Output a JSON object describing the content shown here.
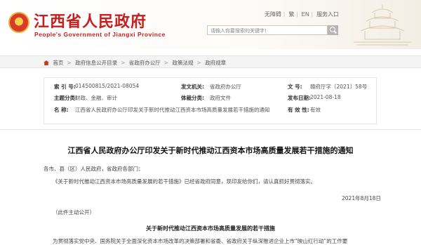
{
  "header": {
    "title": "江西省人民政府",
    "subtitle": "People's Government of Jiangxi Province",
    "links": [
      "无障碍",
      "繁",
      "EN",
      "服务入口"
    ],
    "search_placeholder": "请输入你要搜索的关键字!"
  },
  "breadcrumb": [
    "首页",
    "政府信息公开目录",
    "省政府办公厅",
    "政策法规",
    "政府规章"
  ],
  "meta": {
    "index_label": "索 引 号:",
    "index_value": "014500815/2021-08054",
    "org_label": "发文机关:",
    "org_value": "省政府办公厅",
    "docno_label": "文 号:",
    "docno_value": "赣府厅字〔2021〕58号",
    "category_label": "主题分类:",
    "category_value": "财政、金融、审计",
    "type_label": "体裁分类:",
    "type_value": "政府文件",
    "date_label": "发布日期:",
    "date_value": "2021-08-18",
    "name_label": "名 称:",
    "name_value": "江西省人民政府办公厅印发关于新时代推动江西资本市场高质量发展若干措施的通知",
    "valid_label": "有 效 性:",
    "valid_value": "有效"
  },
  "document": {
    "title": "江西省人民政府办公厅印发关于新时代推动江西资本市场高质量发展若干措施的通知",
    "addressee": "各市、县（区）人民政府，省政府各部门：",
    "body": "《关于新时代推动江西资本市场高质量发展的若干措施》已经省政府同意，现印发给你们，请认真抓好贯彻落实。",
    "date": "2021年8月18日",
    "disclosure": "（此件主动公开）",
    "sub_title": "关于新时代推动江西资本市场高质量发展的若干措施",
    "body2": "为贯彻落实党中央、国务院关于全面深化资本市场改革的决策部署和省委、省政府关于纵深推进企业上市“映山红行动”的工作要"
  }
}
